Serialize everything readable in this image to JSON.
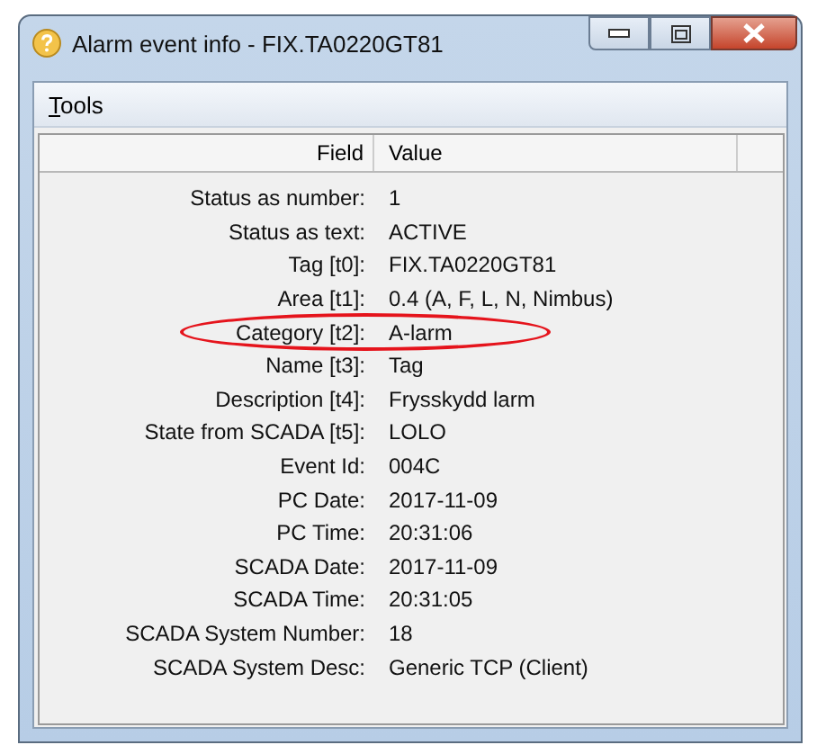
{
  "window": {
    "title": "Alarm event info - FIX.TA0220GT81"
  },
  "menu": [
    {
      "label": "Tools"
    }
  ],
  "table": {
    "columns": [
      "Field",
      "Value"
    ],
    "rows": [
      {
        "field": "Status as number:",
        "value": "1",
        "highlighted": false
      },
      {
        "field": "Status as text:",
        "value": "ACTIVE",
        "highlighted": false
      },
      {
        "field": "Tag [t0]:",
        "value": "FIX.TA0220GT81",
        "highlighted": false
      },
      {
        "field": "Area [t1]:",
        "value": "0.4 (A, F, L, N, Nimbus)",
        "highlighted": false
      },
      {
        "field": "Category [t2]:",
        "value": "A-larm",
        "highlighted": true
      },
      {
        "field": "Name [t3]:",
        "value": "Tag",
        "highlighted": false
      },
      {
        "field": "Description [t4]:",
        "value": "Frysskydd larm",
        "highlighted": false
      },
      {
        "field": "State from SCADA [t5]:",
        "value": "LOLO",
        "highlighted": false
      },
      {
        "field": "Event Id:",
        "value": "004C",
        "highlighted": false
      },
      {
        "field": "PC Date:",
        "value": "2017-11-09",
        "highlighted": false
      },
      {
        "field": "PC Time:",
        "value": "20:31:06",
        "highlighted": false
      },
      {
        "field": "SCADA Date:",
        "value": "2017-11-09",
        "highlighted": false
      },
      {
        "field": "SCADA Time:",
        "value": "20:31:05",
        "highlighted": false
      },
      {
        "field": "SCADA System Number:",
        "value": "18",
        "highlighted": false
      },
      {
        "field": "SCADA System Desc:",
        "value": "Generic TCP (Client)",
        "highlighted": false
      }
    ]
  }
}
